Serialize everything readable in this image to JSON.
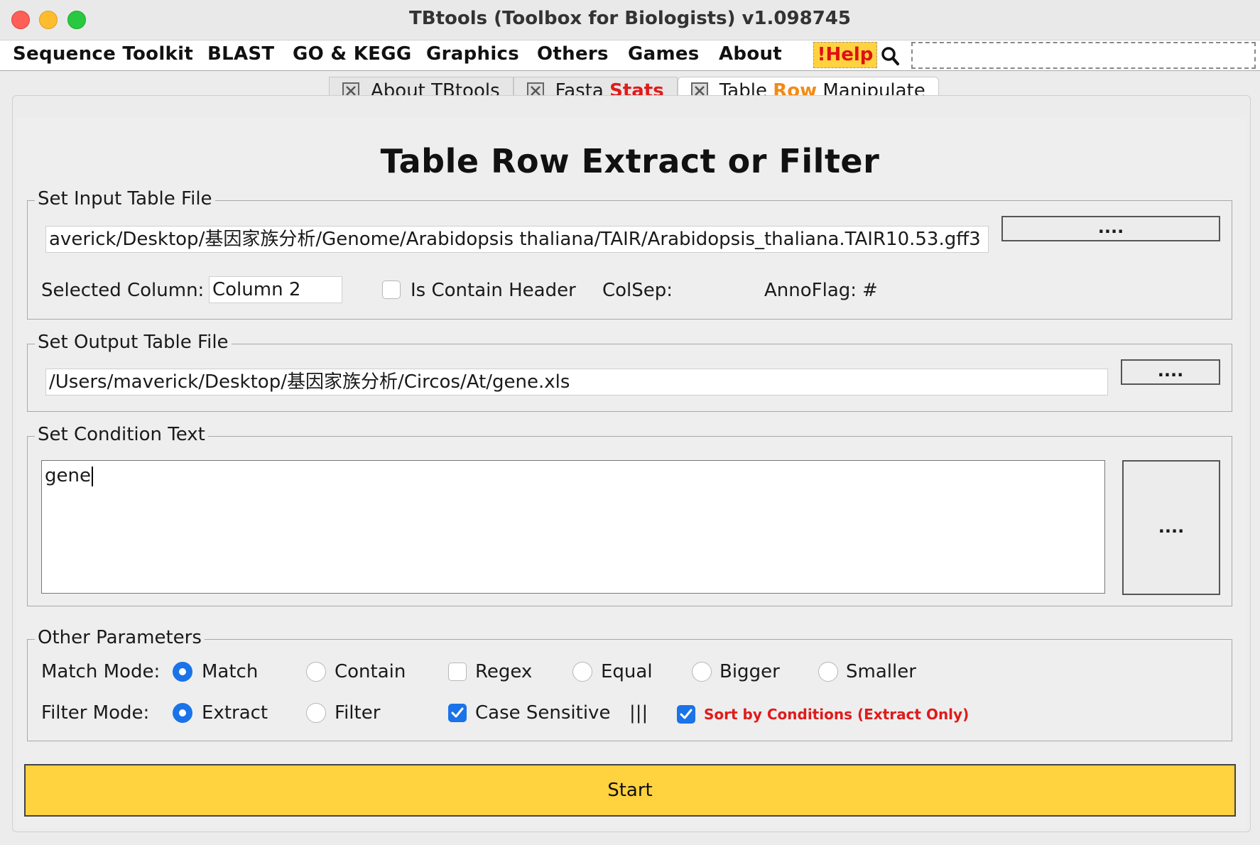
{
  "window": {
    "title": "TBtools (Toolbox for Biologists) v1.098745"
  },
  "menu": {
    "items": [
      "Sequence Toolkit",
      "BLAST",
      "GO & KEGG",
      "Graphics",
      "Others",
      "Games",
      "About"
    ],
    "help_label": "!Help"
  },
  "tabs": [
    {
      "label_plain": "About TBtools",
      "label_hl": "",
      "label_tail": ""
    },
    {
      "label_plain": "Fasta ",
      "label_hl": "Stats",
      "label_tail": ""
    },
    {
      "label_plain": "Table ",
      "label_hl": "Row",
      "label_tail": " Manipulate",
      "active": true
    }
  ],
  "page": {
    "heading": "Table Row Extract or Filter"
  },
  "input_group": {
    "title": "Set Input Table File",
    "path": "averick/Desktop/基因家族分析/Genome/Arabidopsis thaliana/TAIR/Arabidopsis_thaliana.TAIR10.53.gff3",
    "browse_label": "....",
    "selected_column_label": "Selected Column:",
    "selected_column_value": "Column 2",
    "contain_header_label": "Is Contain Header",
    "colsep_label": "ColSep:",
    "annoflag_label": "AnnoFlag:",
    "annoflag_value": "#"
  },
  "output_group": {
    "title": "Set Output Table File",
    "path": "/Users/maverick/Desktop/基因家族分析/Circos/At/gene.xls",
    "browse_label": "...."
  },
  "condition_group": {
    "title": "Set Condition Text",
    "text": "gene",
    "browse_label": "...."
  },
  "params_group": {
    "title": "Other Parameters",
    "match_mode_label": "Match Mode:",
    "match_options": [
      "Match",
      "Contain",
      "Regex",
      "Equal",
      "Bigger",
      "Smaller"
    ],
    "match_selected": "Match",
    "filter_mode_label": "Filter Mode:",
    "filter_options": [
      "Extract",
      "Filter"
    ],
    "filter_selected": "Extract",
    "case_sensitive_label": "Case Sensitive",
    "case_sensitive_checked": true,
    "separator": "|||",
    "sort_label": "Sort by Conditions (Extract Only)",
    "sort_checked": true
  },
  "start_label": "Start",
  "colors": {
    "accent": "#1a73e8",
    "start_bg": "#ffd23f",
    "highlight_red": "#e01b1b",
    "highlight_orange": "#f28a17"
  }
}
